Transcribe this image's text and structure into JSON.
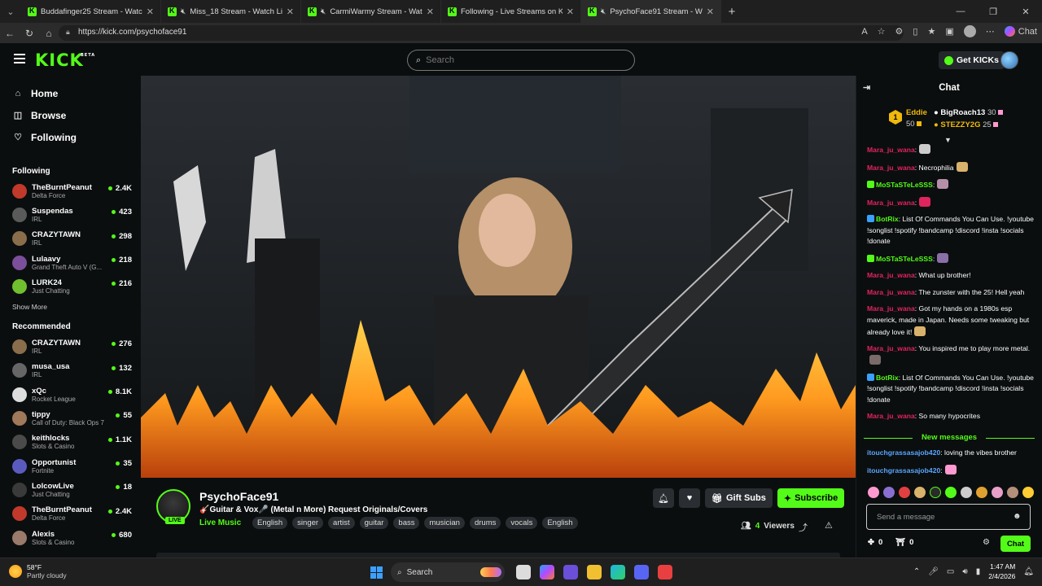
{
  "browser": {
    "tabs": [
      {
        "title": "Buddafinger25 Stream - Watch",
        "muted": false
      },
      {
        "title": "Miss_18 Stream - Watch Live o",
        "muted": true
      },
      {
        "title": "CarmiWarmy Stream - Watch",
        "muted": true
      },
      {
        "title": "Following - Live Streams on Kick",
        "muted": false
      },
      {
        "title": "PsychoFace91 Stream - Watch",
        "muted": true
      }
    ],
    "url": "https://kick.com/psychoface91",
    "copilot_label": "Chat"
  },
  "header": {
    "logo": "KICK",
    "logo_tag": "BETA",
    "search_placeholder": "Search",
    "get_kicks_label": "Get KICKs"
  },
  "sidebar": {
    "nav": [
      {
        "label": "Home",
        "icon": "home-icon"
      },
      {
        "label": "Browse",
        "icon": "browse-icon"
      },
      {
        "label": "Following",
        "icon": "heart-icon"
      }
    ],
    "following_title": "Following",
    "following": [
      {
        "name": "TheBurntPeanut",
        "category": "Delta Force",
        "viewers": "2.4K",
        "color": "#c0392b"
      },
      {
        "name": "Suspendas",
        "category": "IRL",
        "viewers": "423",
        "color": "#5a5a5a"
      },
      {
        "name": "CRAZYTAWN",
        "category": "IRL",
        "viewers": "298",
        "color": "#8a6d4b"
      },
      {
        "name": "Lulaavy",
        "category": "Grand Theft Auto V (G...",
        "viewers": "218",
        "color": "#7b4f9a"
      },
      {
        "name": "LURK24",
        "category": "Just Chatting",
        "viewers": "216",
        "color": "#6fbf2f"
      }
    ],
    "show_more": "Show More",
    "recommended_title": "Recommended",
    "recommended": [
      {
        "name": "CRAZYTAWN",
        "category": "IRL",
        "viewers": "276",
        "color": "#8a6d4b"
      },
      {
        "name": "musa_usa",
        "category": "IRL",
        "viewers": "132",
        "color": "#666666"
      },
      {
        "name": "xQc",
        "category": "Rocket League",
        "viewers": "8.1K",
        "color": "#dddddd"
      },
      {
        "name": "tippy",
        "category": "Call of Duty: Black Ops 7",
        "viewers": "55",
        "color": "#a0785a"
      },
      {
        "name": "keithlocks",
        "category": "Slots & Casino",
        "viewers": "1.1K",
        "color": "#4a4a4a"
      },
      {
        "name": "Opportunist",
        "category": "Fortnite",
        "viewers": "35",
        "color": "#5b5bbf"
      },
      {
        "name": "LolcowLive",
        "category": "Just Chatting",
        "viewers": "18",
        "color": "#3a3a3a"
      },
      {
        "name": "TheBurntPeanut",
        "category": "Delta Force",
        "viewers": "2.4K",
        "color": "#c0392b"
      },
      {
        "name": "Alexis",
        "category": "Slots & Casino",
        "viewers": "680",
        "color": "#9a7a6a"
      }
    ]
  },
  "stream": {
    "streamer": "PsychoFace91",
    "live_label": "LIVE",
    "title": "🎸Guitar & Vox🎤 (Metal n More) Request Originals/Covers",
    "category": "Live Music",
    "tags": [
      "English",
      "singer",
      "artist",
      "guitar",
      "bass",
      "musician",
      "drums",
      "vocals",
      "English"
    ],
    "gift_label": "Gift Subs",
    "subscribe_label": "Subscribe",
    "viewers_count": "4",
    "viewers_label": "Viewers"
  },
  "chat": {
    "title": "Chat",
    "leaderboard": [
      {
        "name": "Eddie",
        "count": "50",
        "color": "#f0b90b"
      },
      {
        "name": "BigRoach13",
        "count": "30",
        "color": "#ffffff"
      },
      {
        "name": "STEZZY2G",
        "count": "25",
        "color": "#f0b90b"
      }
    ],
    "leader_rank": "1",
    "messages": [
      {
        "user": "Mara_ju_wana",
        "color": "red",
        "text": ":",
        "emote": "#cccccc"
      },
      {
        "user": "Mara_ju_wana",
        "color": "red",
        "text": ": Necrophilia",
        "emote": "#d9b26b"
      },
      {
        "user": "MoSTaSTeLeSSS",
        "color": "green",
        "text": ":",
        "emote": "#b58fa8",
        "badge": "#53fc18"
      },
      {
        "user": "Mara_ju_wana",
        "color": "red",
        "text": ":",
        "emote": "#e0245e"
      },
      {
        "user": "BotRix",
        "color": "green",
        "text": ": List Of Commands You Can Use. !youtube !songlist !spotify !bandcamp !discord !insta !socials !donate",
        "badge": "#3aa0ff"
      },
      {
        "user": "MoSTaSTeLeSSS",
        "color": "green",
        "text": ":",
        "emote": "#8a6fa8",
        "badge": "#53fc18"
      },
      {
        "user": "Mara_ju_wana",
        "color": "red",
        "text": ": What up brother!"
      },
      {
        "user": "Mara_ju_wana",
        "color": "red",
        "text": ": The zunster with the 25! Hell yeah"
      },
      {
        "user": "Mara_ju_wana",
        "color": "red",
        "text": ": Got my hands on a 1980s esp maverick, made in Japan. Needs some tweaking but already love it!",
        "emote": "#d9b26b"
      },
      {
        "user": "Mara_ju_wana",
        "color": "red",
        "text": ": You inspired me to play more metal.",
        "emote": "#7a6a6a"
      },
      {
        "user": "BotRix",
        "color": "green",
        "text": ": List Of Commands You Can Use. !youtube !songlist !spotify !bandcamp !discord !insta !socials !donate",
        "badge": "#3aa0ff"
      },
      {
        "user": "Mara_ju_wana",
        "color": "red",
        "text": ": So many hypocrites"
      }
    ],
    "new_messages_label": "New messages",
    "new_messages": [
      {
        "user": "itouchgrassasajob420",
        "color": "blue",
        "text": ": loving the vibes brother"
      },
      {
        "user": "itouchgrassasajob420",
        "color": "blue",
        "text": ":",
        "emote": "#ff9ad0"
      }
    ],
    "input_placeholder": "Send a message",
    "stat_a": "0",
    "stat_b": "0",
    "send_label": "Chat"
  },
  "taskbar": {
    "temp": "58°F",
    "weather": "Partly cloudy",
    "search_label": "Search",
    "time": "1:47 AM",
    "date": "2/4/2026"
  }
}
